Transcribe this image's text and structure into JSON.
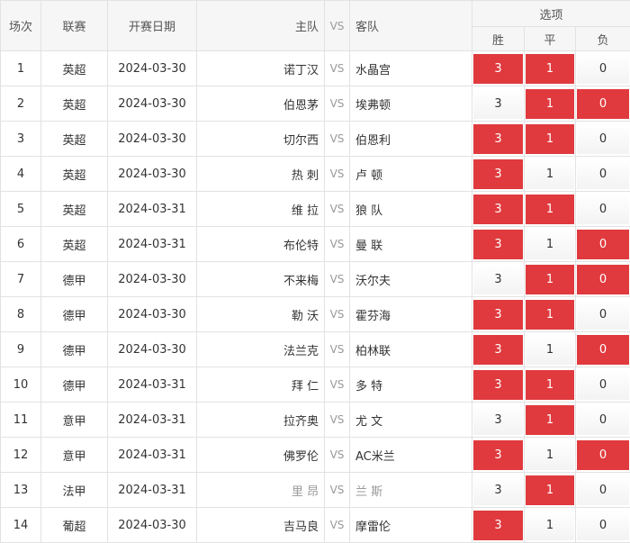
{
  "header": {
    "col_no": "场次",
    "col_league": "联赛",
    "col_date": "开赛日期",
    "col_home": "主队",
    "col_vs": "VS",
    "col_away": "客队",
    "col_options": "选项",
    "opt_win": "胜",
    "opt_draw": "平",
    "opt_lose": "负"
  },
  "vs_text": "VS",
  "rows": [
    {
      "no": "1",
      "league": "英超",
      "date": "2024-03-30",
      "home": "诺丁汉",
      "away": "水晶宫",
      "win": "3",
      "draw": "1",
      "lose": "0",
      "win_sel": true,
      "draw_sel": true,
      "lose_sel": false,
      "muted": false
    },
    {
      "no": "2",
      "league": "英超",
      "date": "2024-03-30",
      "home": "伯恩茅",
      "away": "埃弗顿",
      "win": "3",
      "draw": "1",
      "lose": "0",
      "win_sel": false,
      "draw_sel": true,
      "lose_sel": true,
      "muted": false
    },
    {
      "no": "3",
      "league": "英超",
      "date": "2024-03-30",
      "home": "切尔西",
      "away": "伯恩利",
      "win": "3",
      "draw": "1",
      "lose": "0",
      "win_sel": true,
      "draw_sel": true,
      "lose_sel": false,
      "muted": false
    },
    {
      "no": "4",
      "league": "英超",
      "date": "2024-03-30",
      "home": "热 刺",
      "away": "卢 顿",
      "win": "3",
      "draw": "1",
      "lose": "0",
      "win_sel": true,
      "draw_sel": false,
      "lose_sel": false,
      "muted": false
    },
    {
      "no": "5",
      "league": "英超",
      "date": "2024-03-31",
      "home": "维 拉",
      "away": "狼 队",
      "win": "3",
      "draw": "1",
      "lose": "0",
      "win_sel": true,
      "draw_sel": true,
      "lose_sel": false,
      "muted": false
    },
    {
      "no": "6",
      "league": "英超",
      "date": "2024-03-31",
      "home": "布伦特",
      "away": "曼 联",
      "win": "3",
      "draw": "1",
      "lose": "0",
      "win_sel": true,
      "draw_sel": false,
      "lose_sel": true,
      "muted": false
    },
    {
      "no": "7",
      "league": "德甲",
      "date": "2024-03-30",
      "home": "不来梅",
      "away": "沃尔夫",
      "win": "3",
      "draw": "1",
      "lose": "0",
      "win_sel": false,
      "draw_sel": true,
      "lose_sel": true,
      "muted": false
    },
    {
      "no": "8",
      "league": "德甲",
      "date": "2024-03-30",
      "home": "勒 沃",
      "away": "霍芬海",
      "win": "3",
      "draw": "1",
      "lose": "0",
      "win_sel": true,
      "draw_sel": true,
      "lose_sel": false,
      "muted": false
    },
    {
      "no": "9",
      "league": "德甲",
      "date": "2024-03-30",
      "home": "法兰克",
      "away": "柏林联",
      "win": "3",
      "draw": "1",
      "lose": "0",
      "win_sel": true,
      "draw_sel": false,
      "lose_sel": true,
      "muted": false
    },
    {
      "no": "10",
      "league": "德甲",
      "date": "2024-03-31",
      "home": "拜 仁",
      "away": "多 特",
      "win": "3",
      "draw": "1",
      "lose": "0",
      "win_sel": true,
      "draw_sel": true,
      "lose_sel": false,
      "muted": false
    },
    {
      "no": "11",
      "league": "意甲",
      "date": "2024-03-31",
      "home": "拉齐奥",
      "away": "尤 文",
      "win": "3",
      "draw": "1",
      "lose": "0",
      "win_sel": false,
      "draw_sel": true,
      "lose_sel": false,
      "muted": false
    },
    {
      "no": "12",
      "league": "意甲",
      "date": "2024-03-31",
      "home": "佛罗伦",
      "away": "AC米兰",
      "win": "3",
      "draw": "1",
      "lose": "0",
      "win_sel": true,
      "draw_sel": false,
      "lose_sel": true,
      "muted": false
    },
    {
      "no": "13",
      "league": "法甲",
      "date": "2024-03-31",
      "home": "里 昂",
      "away": "兰 斯",
      "win": "3",
      "draw": "1",
      "lose": "0",
      "win_sel": false,
      "draw_sel": true,
      "lose_sel": false,
      "muted": true
    },
    {
      "no": "14",
      "league": "葡超",
      "date": "2024-03-30",
      "home": "吉马良",
      "away": "摩雷伦",
      "win": "3",
      "draw": "1",
      "lose": "0",
      "win_sel": true,
      "draw_sel": false,
      "lose_sel": false,
      "muted": false
    }
  ],
  "colors": {
    "selected": "#e03a3e",
    "border": "#e2e2e2",
    "header_bg": "#f6f6f6"
  }
}
